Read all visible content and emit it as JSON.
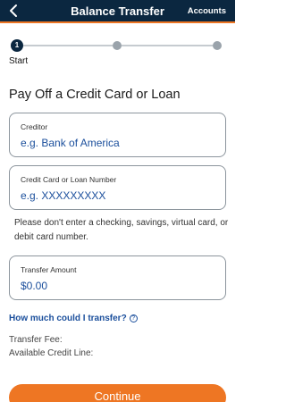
{
  "header": {
    "title": "Balance Transfer",
    "accounts_label": "Accounts"
  },
  "stepper": {
    "active_step_number": "1",
    "active_step_label": "Start",
    "total_steps": 3
  },
  "form": {
    "heading": "Pay Off a Credit Card or Loan",
    "creditor": {
      "label": "Creditor",
      "placeholder": "e.g. Bank of America"
    },
    "account_number": {
      "label": "Credit Card or Loan Number",
      "placeholder": "e.g. XXXXXXXXX"
    },
    "helper_text": "Please don't enter a checking, savings, virtual card, or debit card number.",
    "transfer_amount": {
      "label": "Transfer Amount",
      "value": "$0.00"
    }
  },
  "transfer_link": {
    "label": "How much could I transfer?",
    "icon": "?"
  },
  "info": {
    "transfer_fee_label": "Transfer Fee:",
    "available_credit_label": "Available Credit Line:"
  },
  "actions": {
    "continue_label": "Continue"
  },
  "colors": {
    "header_bg": "#0b2740",
    "accent": "#ee7623",
    "link": "#1b4f9c"
  }
}
